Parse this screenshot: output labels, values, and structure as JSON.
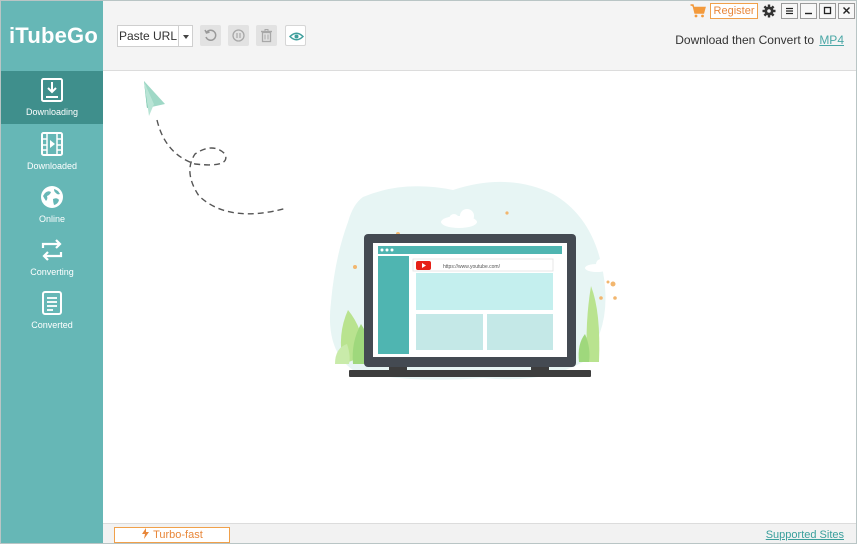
{
  "app": {
    "title": "iTubeGo"
  },
  "sidebar": {
    "items": [
      {
        "label": "Downloading",
        "icon": "download-icon",
        "active": true
      },
      {
        "label": "Downloaded",
        "icon": "film-icon",
        "active": false
      },
      {
        "label": "Online",
        "icon": "globe-icon",
        "active": false
      },
      {
        "label": "Converting",
        "icon": "convert-icon",
        "active": false
      },
      {
        "label": "Converted",
        "icon": "document-icon",
        "active": false
      }
    ]
  },
  "toolbar": {
    "paste_label": "Paste URL",
    "convert_label": "Download then Convert to",
    "convert_format": "MP4"
  },
  "window": {
    "register_label": "Register"
  },
  "illustration": {
    "url_text": "https://www.youtube.com/"
  },
  "footer": {
    "turbo_label": "Turbo-fast",
    "supported_label": "Supported Sites"
  },
  "colors": {
    "sidebar": "#66b7b6",
    "sidebar_active": "#3f8f8c",
    "accent_orange": "#e8873a",
    "link_teal": "#3a9f9c"
  }
}
